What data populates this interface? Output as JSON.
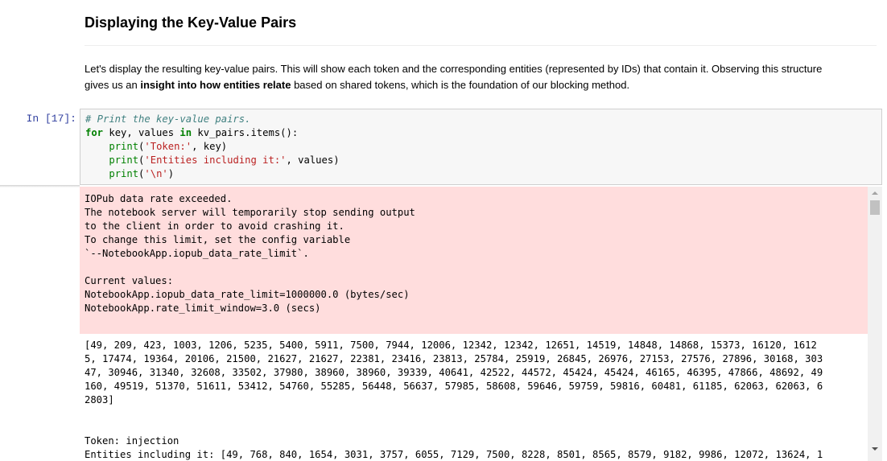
{
  "markdown": {
    "heading": "Displaying the Key-Value Pairs",
    "para_part1": "Let's display the resulting key-value pairs. This will show each token and the corresponding entities (represented by IDs) that contain it. Observing this structure gives us an ",
    "para_bold": "insight into how entities relate",
    "para_part2": " based on shared tokens, which is the foundation of our blocking method."
  },
  "cell": {
    "prompt": "In [17]:",
    "code_line1": "# Print the key-value pairs.",
    "code_line2_kw1": "for",
    "code_line2_mid": " key, values ",
    "code_line2_kw2": "in",
    "code_line2_end": " kv_pairs.items():",
    "code_line3_pre": "    ",
    "code_line3_fn": "print",
    "code_line3_open": "(",
    "code_line3_str": "'Token:'",
    "code_line3_end": ", key)",
    "code_line4_pre": "    ",
    "code_line4_fn": "print",
    "code_line4_open": "(",
    "code_line4_str": "'Entities including it:'",
    "code_line4_end": ", values)",
    "code_line5_pre": "    ",
    "code_line5_fn": "print",
    "code_line5_open": "(",
    "code_line5_str": "'\\n'",
    "code_line5_end": ")"
  },
  "output": {
    "stderr_text": "IOPub data rate exceeded.\nThe notebook server will temporarily stop sending output\nto the client in order to avoid crashing it.\nTo change this limit, set the config variable\n`--NotebookApp.iopub_data_rate_limit`.\n\nCurrent values:\nNotebookApp.iopub_data_rate_limit=1000000.0 (bytes/sec)\nNotebookApp.rate_limit_window=3.0 (secs)",
    "stdout_list": "[49, 209, 423, 1003, 1206, 5235, 5400, 5911, 7500, 7944, 12006, 12342, 12342, 12651, 14519, 14848, 14868, 15373, 16120, 1612\n5, 17474, 19364, 20106, 21500, 21627, 21627, 22381, 23416, 23813, 25784, 25919, 26845, 26976, 27153, 27576, 27896, 30168, 303\n47, 30946, 31340, 32608, 33502, 37980, 38960, 38960, 39339, 40641, 42522, 44572, 45424, 45424, 46165, 46395, 47866, 48692, 49\n160, 49519, 51370, 51611, 53412, 54760, 55285, 56448, 56637, 57985, 58608, 59646, 59759, 59816, 60481, 61185, 62063, 62063, 6\n2803]",
    "stdout_token": "Token: injection\nEntities including it: [49, 768, 840, 1654, 3031, 3757, 6055, 7129, 7500, 8228, 8501, 8565, 8579, 9182, 9986, 12072, 13624, 1"
  },
  "colors": {
    "prompt": "#303f9f",
    "stderr_bg": "#ffdddd",
    "code_bg": "#f7f7f7",
    "keyword": "#008000",
    "string": "#ba2121",
    "comment": "#408080"
  },
  "icons": [
    "scroll-up-arrow-icon",
    "scroll-down-arrow-icon"
  ]
}
